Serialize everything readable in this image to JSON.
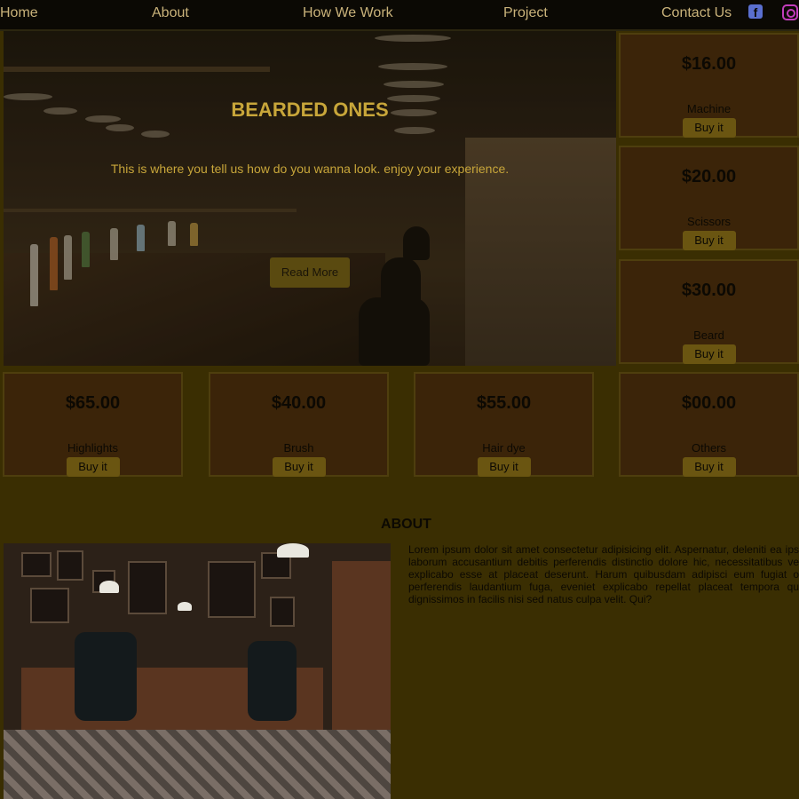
{
  "nav": {
    "items": [
      "Home",
      "About",
      "How We Work",
      "Project",
      "Contact Us"
    ],
    "social": [
      "facebook-icon",
      "instagram-icon"
    ]
  },
  "hero": {
    "title": "BEARDED ONES",
    "subtitle": "This is where you tell us how do you wanna look. enjoy your experience.",
    "button": "Read More"
  },
  "products": [
    {
      "price": "$16.00",
      "name": "Machine",
      "button": "Buy it"
    },
    {
      "price": "$20.00",
      "name": "Scissors",
      "button": "Buy it"
    },
    {
      "price": "$30.00",
      "name": "Beard",
      "button": "Buy it"
    },
    {
      "price": "$65.00",
      "name": "Highlights",
      "button": "Buy it"
    },
    {
      "price": "$40.00",
      "name": "Brush",
      "button": "Buy it"
    },
    {
      "price": "$55.00",
      "name": "Hair dye",
      "button": "Buy it"
    },
    {
      "price": "$00.00",
      "name": "Others",
      "button": "Buy it"
    }
  ],
  "about": {
    "title": "ABOUT",
    "text": "Lorem ipsum dolor sit amet consectetur adipisicing elit. Aspernatur, deleniti ea ips laborum accusantium debitis perferendis distinctio dolore hic, necessitatibus ve explicabo esse at placeat deserunt. Harum quibusdam adipisci eum fugiat o perferendis laudantium fuga, eveniet explicabo repellat placeat tempora qu dignissimos in facilis nisi sed natus culpa velit. Qui?"
  },
  "colors": {
    "page_bg": "#3a2e02",
    "nav_bg": "#0b0904",
    "accent_gold": "#c8a63a",
    "card_bg": "#3b2409",
    "button_bg": "#6a5511"
  }
}
